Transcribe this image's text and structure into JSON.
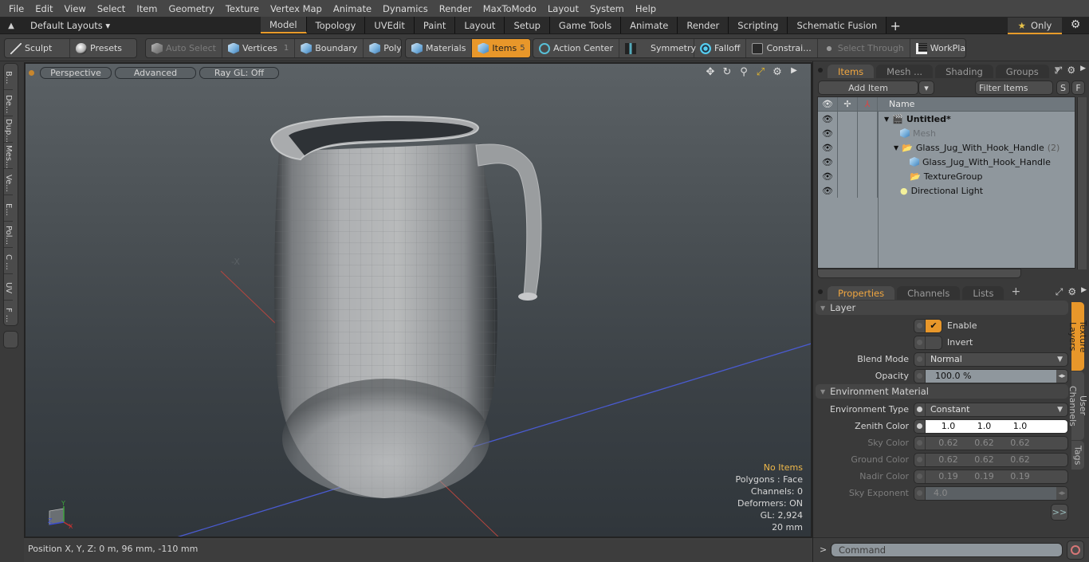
{
  "menu": [
    "File",
    "Edit",
    "View",
    "Select",
    "Item",
    "Geometry",
    "Texture",
    "Vertex Map",
    "Animate",
    "Dynamics",
    "Render",
    "MaxToModo",
    "Layout",
    "System",
    "Help"
  ],
  "layout_selector": {
    "label": "Default Layouts ▾"
  },
  "layout_tabs": [
    "Model",
    "Topology",
    "UVEdit",
    "Paint",
    "Layout",
    "Setup",
    "Game Tools",
    "Animate",
    "Render",
    "Scripting",
    "Schematic Fusion"
  ],
  "active_layout_tab": "Model",
  "only_button": {
    "star": "★",
    "label": "Only"
  },
  "toolbar": {
    "sculpt": "Sculpt",
    "presets": "Presets",
    "auto_select": "Auto Select",
    "vertices": "Vertices",
    "vertices_count": "1",
    "boundary": "Boundary",
    "polygons": "Polygons",
    "materials": "Materials",
    "items": "Items",
    "items_count": "5",
    "action_center": "Action Center",
    "symmetry": "Symmetry",
    "falloff": "Falloff",
    "constraints": "Constrai...",
    "select_through": "Select Through",
    "workplane": "WorkPlane"
  },
  "left_tabs": [
    "B...",
    "De...",
    "Dup...",
    "Mes...",
    "Ve...",
    "E...",
    "Pol...",
    "C ...",
    "UV",
    "F ..."
  ],
  "viewport": {
    "view_mode": "Perspective",
    "shading": "Advanced",
    "raygl": "Ray GL: Off",
    "info": {
      "selection": "No Items",
      "polygons": "Polygons : Face",
      "channels": "Channels: 0",
      "deformers": "Deformers: ON",
      "gl": "GL: 2,924",
      "grid": "20 mm"
    },
    "axis_labels": {
      "x": "X",
      "y": "Y",
      "z": "Z"
    }
  },
  "status": {
    "position": "Position X, Y, Z:   0 m, 96 mm, -110 mm"
  },
  "items_panel": {
    "tabs": [
      "Items",
      "Mesh ...",
      "Shading",
      "Groups"
    ],
    "active_tab": "Items",
    "add_item": "Add Item",
    "filter_placeholder": "Filter Items",
    "s_btn": "S",
    "f_btn": "F",
    "column_name": "Name",
    "tree": [
      {
        "name": "Untitled*",
        "type": "scene",
        "depth": 0,
        "bold": true
      },
      {
        "name": "Mesh",
        "type": "mesh",
        "depth": 1,
        "dim": true
      },
      {
        "name": "Glass_Jug_With_Hook_Handle",
        "count": "(2)",
        "type": "group",
        "depth": 1
      },
      {
        "name": "Glass_Jug_With_Hook_Handle",
        "type": "mesh",
        "depth": 2
      },
      {
        "name": "TextureGroup",
        "type": "group",
        "depth": 2
      },
      {
        "name": "Directional Light",
        "type": "light",
        "depth": 1
      }
    ]
  },
  "properties_panel": {
    "tabs": [
      "Properties",
      "Channels",
      "Lists"
    ],
    "active_tab": "Properties",
    "layer_section": "Layer",
    "enable": {
      "label": "Enable",
      "checked": true
    },
    "invert": {
      "label": "Invert",
      "checked": false
    },
    "blend_mode": {
      "label": "Blend Mode",
      "value": "Normal"
    },
    "opacity": {
      "label": "Opacity",
      "value": "100.0 %"
    },
    "env_section": "Environment Material",
    "env_type": {
      "label": "Environment Type",
      "value": "Constant"
    },
    "zenith": {
      "label": "Zenith Color",
      "values": [
        "1.0",
        "1.0",
        "1.0"
      ]
    },
    "sky": {
      "label": "Sky Color",
      "values": [
        "0.62",
        "0.62",
        "0.62"
      ]
    },
    "ground": {
      "label": "Ground Color",
      "values": [
        "0.62",
        "0.62",
        "0.62"
      ]
    },
    "nadir": {
      "label": "Nadir Color",
      "values": [
        "0.19",
        "0.19",
        "0.19"
      ]
    },
    "sky_exponent": {
      "label": "Sky Exponent",
      "value": "4.0"
    },
    "more_btn": ">>",
    "side_tabs": [
      "Texture Layers",
      "User Channels",
      "Tags"
    ]
  },
  "command": {
    "prompt": ">",
    "placeholder": "Command"
  }
}
